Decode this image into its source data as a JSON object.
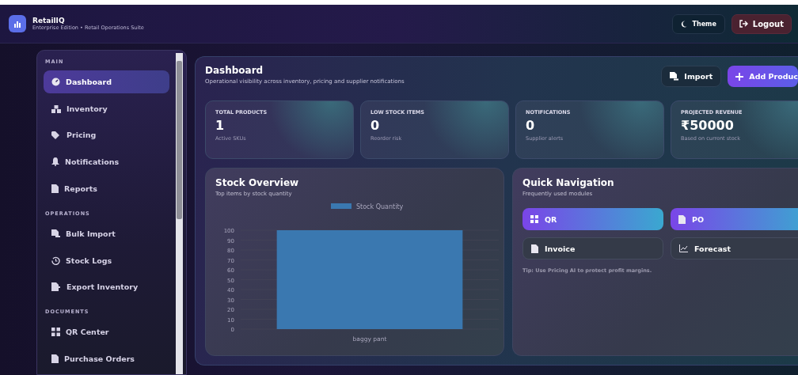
{
  "app": {
    "name": "RetailIQ",
    "subtitle": "Enterprise Edition • Retail Operations Suite"
  },
  "header_buttons": [
    {
      "kind": "theme",
      "label": "Theme"
    },
    {
      "kind": "logout",
      "label": "Logout"
    }
  ],
  "sidebar": {
    "sections": [
      {
        "title": "MAIN",
        "items": [
          {
            "label": "Dashboard",
            "selected": true
          },
          {
            "label": "Inventory",
            "selected": false
          },
          {
            "label": "Pricing",
            "selected": false
          },
          {
            "label": "Notifications",
            "selected": false
          },
          {
            "label": "Reports",
            "selected": false
          }
        ]
      },
      {
        "title": "OPERATIONS",
        "items": [
          {
            "label": "Bulk Import",
            "selected": false
          },
          {
            "label": "Stock Logs",
            "selected": false
          },
          {
            "label": "Export Inventory",
            "selected": false
          }
        ]
      },
      {
        "title": "DOCUMENTS",
        "items": [
          {
            "label": "QR Center",
            "selected": false
          },
          {
            "label": "Purchase Orders",
            "selected": false
          }
        ]
      }
    ]
  },
  "page": {
    "title": "Dashboard",
    "subtitle": "Operational visibility across inventory, pricing and supplier notifications",
    "actions": [
      {
        "kind": "secondary",
        "label": "Import"
      },
      {
        "kind": "primary",
        "label": "Add Produc"
      }
    ]
  },
  "stats": [
    {
      "label": "TOTAL PRODUCTS",
      "value": "1",
      "note": "Active SKUs"
    },
    {
      "label": "LOW STOCK ITEMS",
      "value": "0",
      "note": "Reorder risk"
    },
    {
      "label": "NOTIFICATIONS",
      "value": "0",
      "note": "Supplier alerts"
    },
    {
      "label": "PROJECTED REVENUE",
      "value": "₹50000",
      "note": "Based on current stock"
    }
  ],
  "stock_overview": {
    "title": "Stock Overview",
    "subtitle": "Top items by stock quantity",
    "chart_data": {
      "type": "bar",
      "categories": [
        "baggy pant"
      ],
      "series": [
        {
          "name": "Stock Quantity",
          "color": "#3a78b0",
          "values": [
            100
          ]
        }
      ],
      "ylim": [
        0,
        100
      ],
      "grid": true,
      "yticks": [
        0,
        10,
        20,
        30,
        40,
        50,
        60,
        70,
        80,
        90,
        100
      ]
    }
  },
  "quick_navigation": {
    "title": "Quick Navigation",
    "subtitle": "Frequently used modules",
    "links": [
      {
        "label": "QR",
        "kind": "primary"
      },
      {
        "label": "PO",
        "kind": "primary"
      },
      {
        "label": "Invoice",
        "kind": "secondary"
      },
      {
        "label": "Forecast",
        "kind": "secondary"
      }
    ],
    "tip": "Tip: Use Pricing AI to protect profit margins."
  }
}
